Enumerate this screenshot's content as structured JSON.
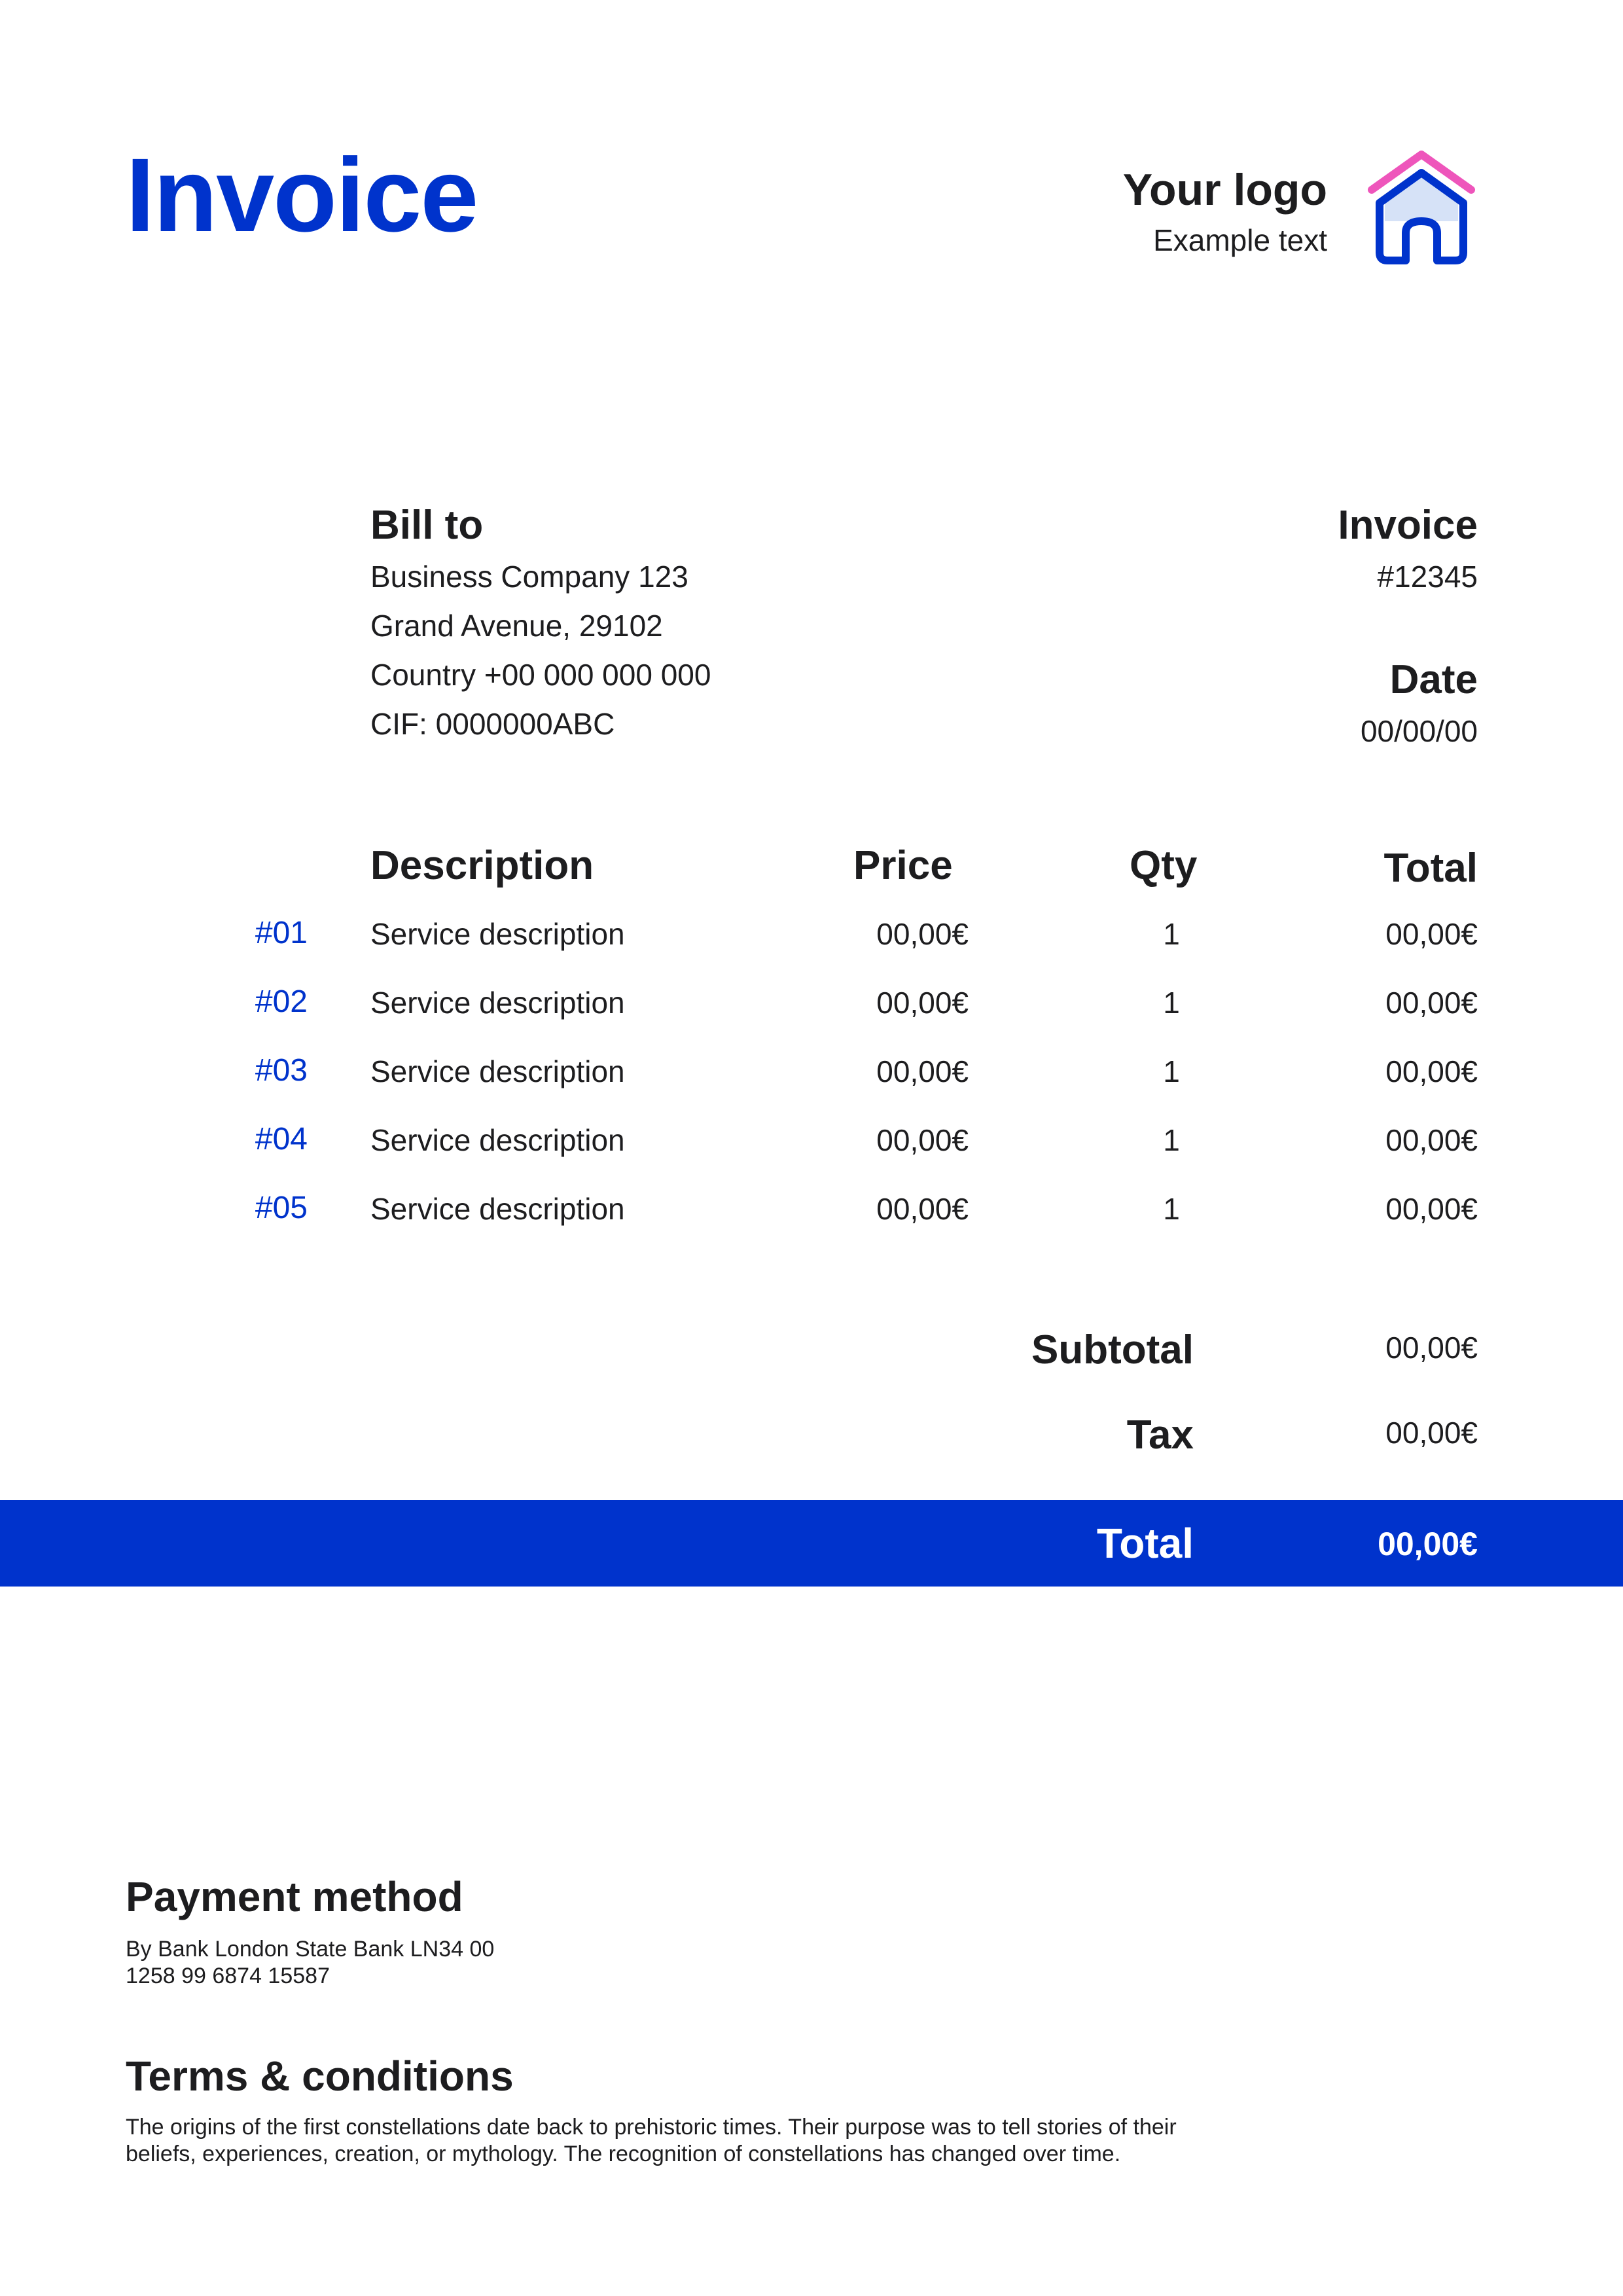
{
  "header": {
    "title": "Invoice",
    "logo_title": "Your logo",
    "logo_subtitle": "Example text",
    "logo_icon": "house-icon",
    "accent_color": "#0033cc",
    "icon_roof_color": "#ee55bb"
  },
  "bill_to": {
    "title": "Bill to",
    "lines": [
      "Business Company 123",
      "Grand Avenue, 29102",
      "Country +00 000 000 000",
      "CIF: 0000000ABC"
    ]
  },
  "invoice_meta": {
    "invoice_label": "Invoice",
    "invoice_number": "#12345",
    "date_label": "Date",
    "date_value": "00/00/00"
  },
  "items_table": {
    "headers": {
      "description": "Description",
      "price": "Price",
      "qty": "Qty",
      "total": "Total"
    },
    "rows": [
      {
        "num": "#01",
        "description": "Service description",
        "price": "00,00€",
        "qty": "1",
        "total": "00,00€"
      },
      {
        "num": "#02",
        "description": "Service description",
        "price": "00,00€",
        "qty": "1",
        "total": "00,00€"
      },
      {
        "num": "#03",
        "description": "Service description",
        "price": "00,00€",
        "qty": "1",
        "total": "00,00€"
      },
      {
        "num": "#04",
        "description": "Service description",
        "price": "00,00€",
        "qty": "1",
        "total": "00,00€"
      },
      {
        "num": "#05",
        "description": "Service description",
        "price": "00,00€",
        "qty": "1",
        "total": "00,00€"
      }
    ]
  },
  "totals": {
    "subtotal_label": "Subtotal",
    "subtotal_value": "00,00€",
    "tax_label": "Tax",
    "tax_value": "00,00€",
    "total_label": "Total",
    "total_value": "00,00€"
  },
  "payment": {
    "title": "Payment method",
    "lines": [
      "By Bank London State Bank LN34 00",
      "1258 99 6874 15587"
    ]
  },
  "terms": {
    "title": "Terms & conditions",
    "lines": [
      "The origins of the first constellations date back to prehistoric times. Their purpose was to tell stories of their",
      "beliefs, experiences, creation, or mythology. The recognition of constellations has changed over time."
    ]
  }
}
